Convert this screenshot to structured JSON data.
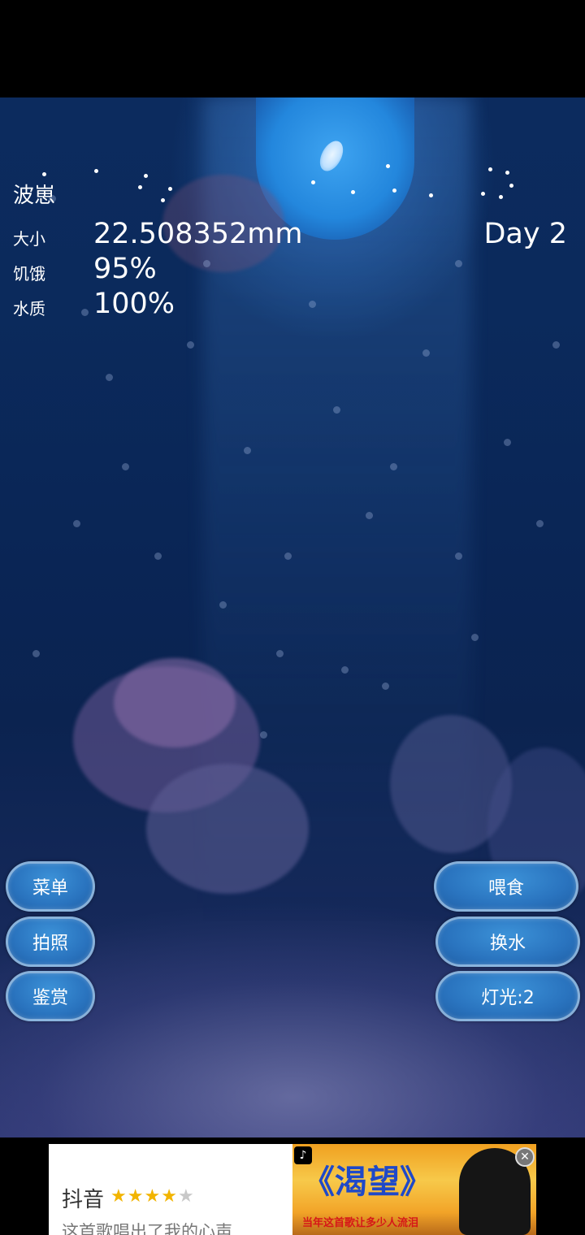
{
  "hud": {
    "name": "波崽",
    "stats": [
      {
        "label": "大小",
        "value": "22.508352mm"
      },
      {
        "label": "饥饿",
        "value": "95%"
      },
      {
        "label": "水质",
        "value": "100%"
      }
    ],
    "day": "Day 2"
  },
  "buttons": {
    "menu": "菜单",
    "photo": "拍照",
    "appreciate": "鉴赏",
    "feed": "喂食",
    "change_water": "换水",
    "light": "灯光:2"
  },
  "ad": {
    "app_name": "抖音",
    "rating": 4,
    "rating_max": 5,
    "description": "这首歌唱出了我的心声...",
    "banner_title": "《渴望》",
    "banner_subtitle": "当年这首歌让多少人流泪",
    "close_icon": "close-icon",
    "brand_icon": "tiktok-icon"
  }
}
